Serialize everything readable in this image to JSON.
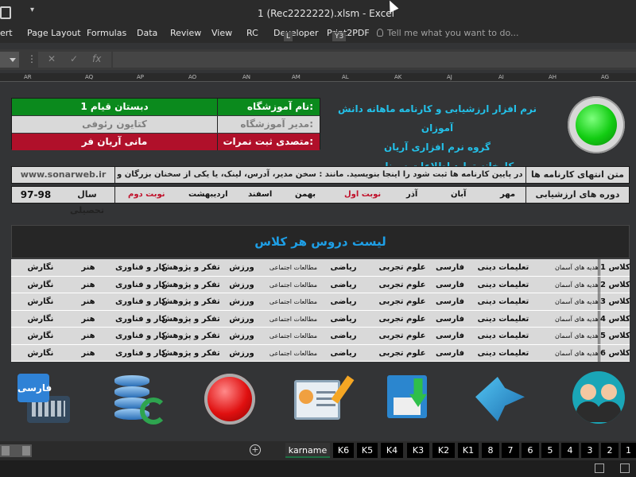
{
  "window": {
    "title": "1 (Rec2222222).xlsm  -  Excel",
    "quick_access_arrow": "▾"
  },
  "ribbon": {
    "tabs": [
      "ert",
      "Page Layout",
      "Formulas",
      "Data",
      "Review",
      "View",
      "RC",
      "Developer",
      "Print2PDF"
    ],
    "tell_me": "Tell me what you want to do...",
    "keytips": [
      "L",
      "Y3"
    ]
  },
  "formula_bar": {
    "cancel": "✕",
    "enter": "✓",
    "fx": "fx",
    "dots": "⋮"
  },
  "columns": [
    "AR",
    "AQ",
    "AP",
    "AO",
    "AN",
    "AM",
    "AL",
    "AK",
    "AJ",
    "AI",
    "AH",
    "AG"
  ],
  "info": {
    "school_label": "نام آموزشگاه:",
    "school_value": "دبستان قیام 1",
    "manager_label": "مدیر آموزشگاه:",
    "manager_value": "کتایون رئوفی",
    "entry_label": "متصدی ثبت نمرات:",
    "entry_value": "مانی آریان فر"
  },
  "header_lines": [
    "نرم افزار ارزشیابی و کارنامه ماهانه دانش آموزان",
    "گروه نرم افزاری آریان",
    "کارخانه تولید اطلاعات سونار وب"
  ],
  "footer_text": {
    "label": "متن انتهای کارنامه ها",
    "text": "جمله ای که می خواهید در پایین کارنامه ها ثبت شود را اینجا بنویسید. مانند : سخن مدیر، آدرس، لینک، یا یکی از سخنان بزرگان و ...",
    "url": "www.sonarweb.ir"
  },
  "periods": {
    "label": "دوره های ارزشیابی",
    "months": [
      "مهر",
      "آبان",
      "آذر",
      "نوبت اول",
      "بهمن",
      "اسفند",
      "اردیبهشت",
      "نوبت دوم"
    ],
    "year_label": "سال تحصیلی",
    "year": "97-98"
  },
  "list_title": "لیست دروس هر کلاس",
  "classes": [
    {
      "name": "کلاس 1",
      "subjects": [
        "هدیه های آسمان",
        "تعلیمات دینی",
        "فارسی",
        "علوم تجربی",
        "ریاضی",
        "مطالعات اجتماعی",
        "ورزش",
        "تفکر و پژوهش",
        "کار و فناوری",
        "هنر",
        "نگارش"
      ]
    },
    {
      "name": "کلاس 2",
      "subjects": [
        "هدیه های آسمان",
        "تعلیمات دینی",
        "فارسی",
        "علوم تجربی",
        "ریاضی",
        "مطالعات اجتماعی",
        "ورزش",
        "تفکر و پژوهش",
        "کار و فناوری",
        "هنر",
        "نگارش"
      ]
    },
    {
      "name": "کلاس 3",
      "subjects": [
        "هدیه های آسمان",
        "تعلیمات دینی",
        "فارسی",
        "علوم تجربی",
        "ریاضی",
        "مطالعات اجتماعی",
        "ورزش",
        "تفکر و پژوهش",
        "کار و فناوری",
        "هنر",
        "نگارش"
      ]
    },
    {
      "name": "کلاس 4",
      "subjects": [
        "هدیه های آسمان",
        "تعلیمات دینی",
        "فارسی",
        "علوم تجربی",
        "ریاضی",
        "مطالعات اجتماعی",
        "ورزش",
        "تفکر و پژوهش",
        "کار و فناوری",
        "هنر",
        "نگارش"
      ]
    },
    {
      "name": "کلاس 5",
      "subjects": [
        "هدیه های آسمان",
        "تعلیمات دینی",
        "فارسی",
        "علوم تجربی",
        "ریاضی",
        "مطالعات اجتماعی",
        "ورزش",
        "تفکر و پژوهش",
        "کار و فناوری",
        "هنر",
        "نگارش"
      ]
    },
    {
      "name": "کلاس 6",
      "subjects": [
        "هدیه های آسمان",
        "تعلیمات دینی",
        "فارسی",
        "علوم تجربی",
        "ریاضی",
        "مطالعات اجتماعی",
        "ورزش",
        "تفکر و پژوهش",
        "کار و فناوری",
        "هنر",
        "نگارش"
      ]
    }
  ],
  "keyboard_badge": "فارسی",
  "sheet_tabs": [
    "karname",
    "K6",
    "K5",
    "K4",
    "K3",
    "K2",
    "K1",
    "8",
    "7",
    "6",
    "5",
    "4",
    "3",
    "2",
    "1"
  ],
  "icons": [
    "keyboard-fa-icon",
    "database-sync-icon",
    "red-button-icon",
    "id-card-icon",
    "save-download-icon",
    "next-arrow-icon",
    "people-icon"
  ],
  "colors": {
    "accent": "#23c0e8",
    "title_blue": "#1e9fe6",
    "green": "#0b8a1d",
    "red": "#b0102a"
  }
}
